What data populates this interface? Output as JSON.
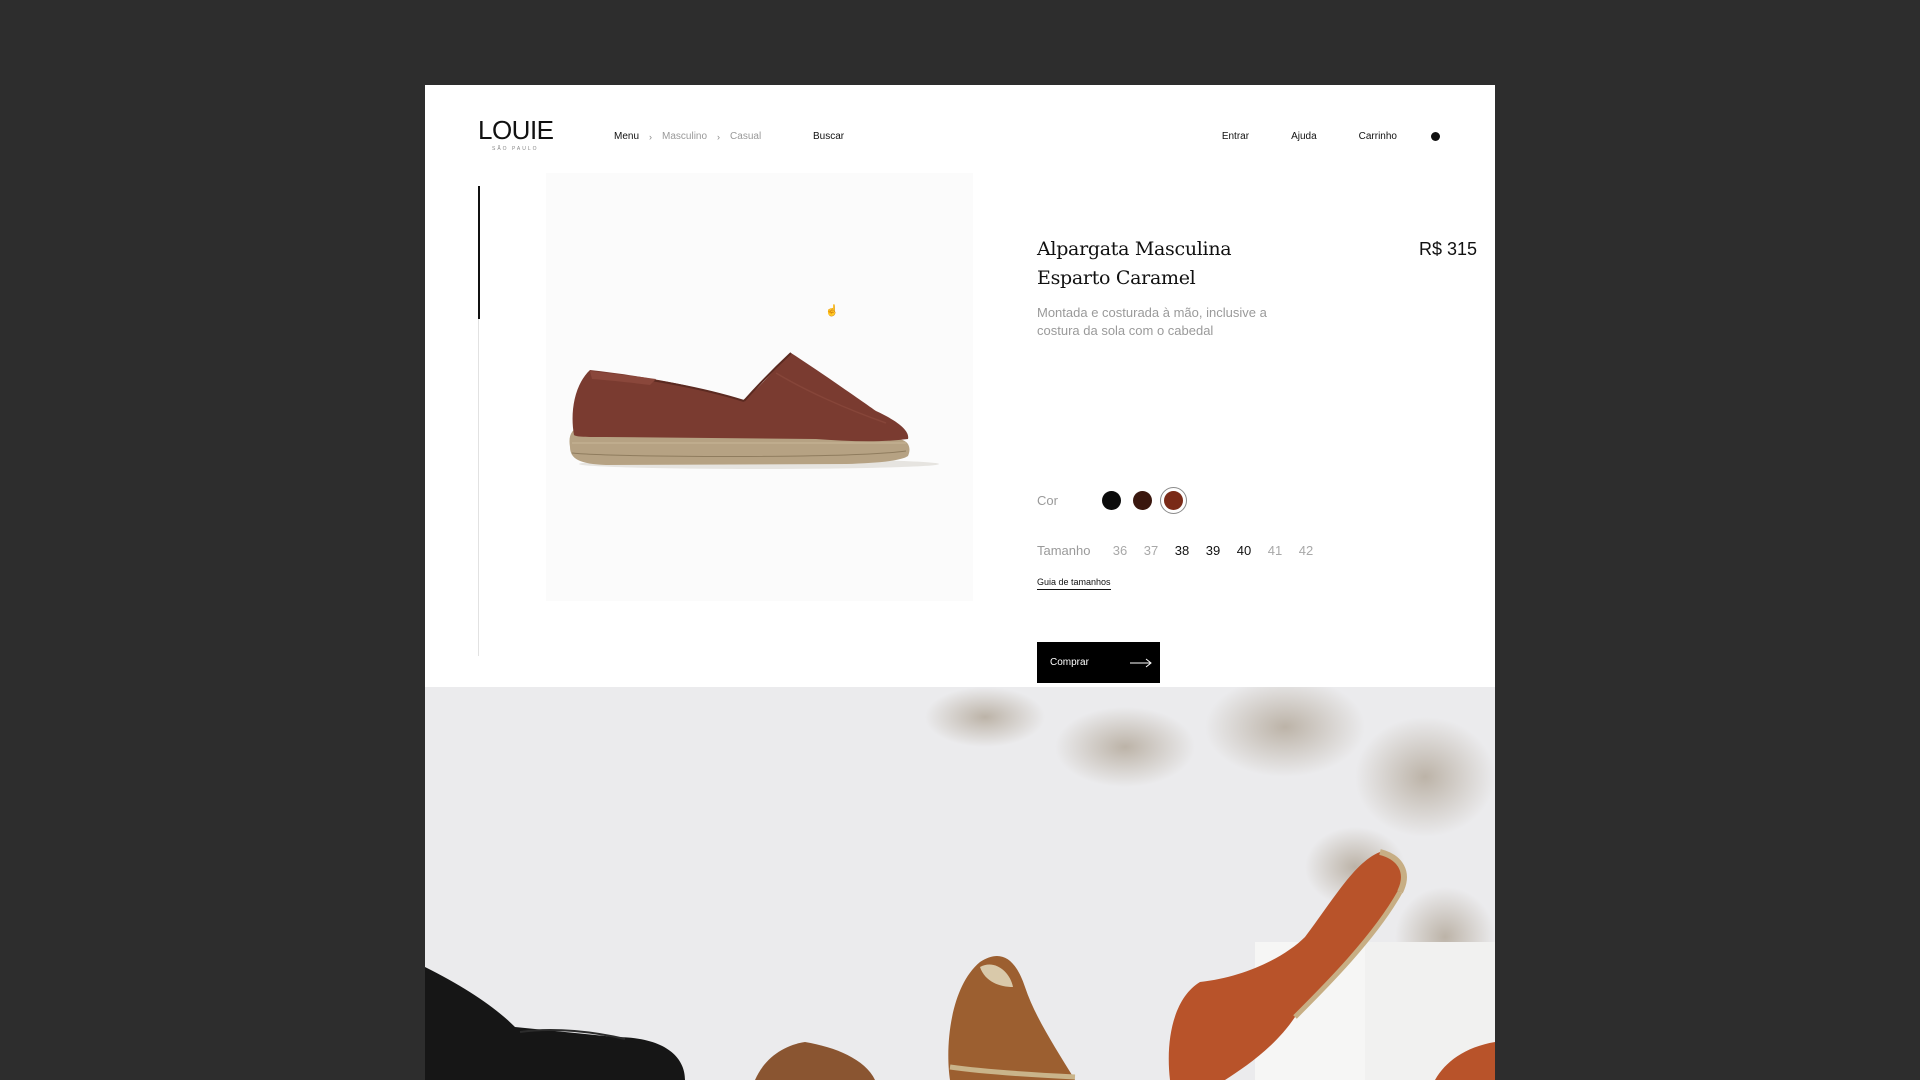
{
  "brand": {
    "name": "LOUIE",
    "tagline": "SÃO PAULO"
  },
  "breadcrumb": {
    "items": [
      "Menu",
      "Masculino",
      "Casual"
    ]
  },
  "header": {
    "search_label": "Buscar",
    "nav": [
      "Entrar",
      "Ajuda",
      "Carrinho"
    ]
  },
  "product": {
    "title": "Alpargata Masculina Esparto Caramel",
    "price": "R$ 315",
    "description": "Montada e costurada à mão, inclusive a costura da sola com o cabedal",
    "color_label": "Cor",
    "colors": [
      {
        "name": "black",
        "hex": "#0b0b0b"
      },
      {
        "name": "dark-brown",
        "hex": "#3a170e"
      },
      {
        "name": "caramel",
        "hex": "#7a2a17",
        "selected": true
      }
    ],
    "size_label": "Tamanho",
    "sizes": [
      {
        "label": "36",
        "available": false
      },
      {
        "label": "37",
        "available": false
      },
      {
        "label": "38",
        "available": true
      },
      {
        "label": "39",
        "available": true
      },
      {
        "label": "40",
        "available": true
      },
      {
        "label": "41",
        "available": false
      },
      {
        "label": "42",
        "available": false
      }
    ],
    "size_guide_label": "Guia de tamanhos",
    "buy_label": "Comprar"
  },
  "icons": {
    "cursor": "hand-pointer-icon",
    "buy_arrow": "arrow-right-icon",
    "crumb_separator": "chevron-right-icon",
    "cart_indicator": "dot-icon"
  }
}
